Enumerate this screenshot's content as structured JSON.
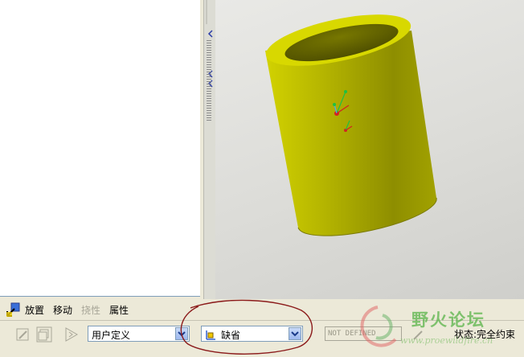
{
  "tabs": [
    {
      "label": "放置",
      "enabled": true
    },
    {
      "label": "移动",
      "enabled": true
    },
    {
      "label": "挠性",
      "enabled": false
    },
    {
      "label": "属性",
      "enabled": true
    }
  ],
  "dashboard": {
    "constraint_type": "用户定义",
    "constraint_set": "缺省",
    "not_defined_label": "NOT DEFINED",
    "status_text": "状态:完全约束"
  },
  "watermark": {
    "brand": "野火论坛",
    "url": "www.proewildfire.cn"
  },
  "colors": {
    "model_fill": "#a8a800",
    "viewport_bg": "#dcdcd8",
    "annotation_circle": "#8b1a1a",
    "axis_x": "#d42020",
    "axis_y": "#20c040"
  },
  "icons": [
    "place-icon",
    "constraint-edit-icon",
    "copy-icon",
    "flexible-icon",
    "csys-icon",
    "pencil-icon"
  ]
}
